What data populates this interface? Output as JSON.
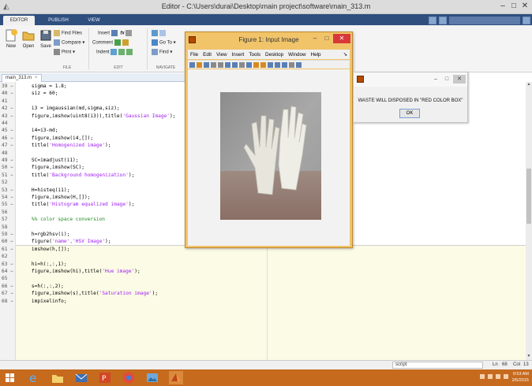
{
  "window": {
    "title": "Editor - C:\\Users\\durai\\Desktop\\main project\\software\\main_313.m",
    "controls": [
      "–",
      "□",
      "✕"
    ]
  },
  "ribbon_tabs": [
    {
      "label": "EDITOR"
    },
    {
      "label": "PUBLISH"
    },
    {
      "label": "VIEW"
    }
  ],
  "ribbon": {
    "new_label": "New",
    "open_label": "Open",
    "save_label": "Save",
    "find_files_label": "Find Files",
    "compare_label": "Compare ▾",
    "print_label": "Print ▾",
    "insert_label": "Insert",
    "comment_label": "Comment",
    "indent_label": "Indent",
    "goto_label": "Go To ▾",
    "find_label": "Find ▾",
    "section_file": "FILE",
    "section_edit": "EDIT",
    "section_navigate": "NAVIGATE"
  },
  "editor": {
    "doc_tab": "main_313.m",
    "lines": [
      {
        "n": "39 −",
        "code": "    sigma = 1.8;"
      },
      {
        "n": "40 −",
        "code": "    siz = 60;"
      },
      {
        "n": "41",
        "code": ""
      },
      {
        "n": "42 −",
        "code": "    i3 = imgaussian(md,sigma,siz);"
      },
      {
        "n": "43 −",
        "code": "    figure,imshow(uint8(i3)),title(",
        "str": "'Gaussian Image'",
        "tail": ");"
      },
      {
        "n": "44",
        "code": ""
      },
      {
        "n": "45 −",
        "code": "    i4=i3-md;"
      },
      {
        "n": "46 −",
        "code": "    figure,imshow(i4,[]);"
      },
      {
        "n": "47 −",
        "code": "    title(",
        "str": "'Homogenized image'",
        "tail": ");"
      },
      {
        "n": "48",
        "code": ""
      },
      {
        "n": "49 −",
        "code": "    SC=imadjust(i1);"
      },
      {
        "n": "50 −",
        "code": "    figure,imshow(SC);"
      },
      {
        "n": "51 −",
        "code": "    title(",
        "str": "'Background homogenization'",
        "tail": ");"
      },
      {
        "n": "52",
        "code": ""
      },
      {
        "n": "53 −",
        "code": "    H=histeq(i1);"
      },
      {
        "n": "54 −",
        "code": "    figure,imshow(H,[]);"
      },
      {
        "n": "55 −",
        "code": "    title(",
        "str": "'Histogram equalized image'",
        "tail": ");"
      },
      {
        "n": "56",
        "code": ""
      },
      {
        "n": "57",
        "code": "    ",
        "cmt": "%% color space conversion"
      },
      {
        "n": "58",
        "code": ""
      },
      {
        "n": "59 −",
        "code": "    h=rgb2hsv(i);"
      },
      {
        "n": "60 −",
        "code": "    figure(",
        "str": "'name','HSV Image'",
        "tail": ");"
      },
      {
        "n": "61 −",
        "code": "    imshow(h,[]);"
      },
      {
        "n": "62",
        "code": ""
      },
      {
        "n": "63 −",
        "code": "    hi=h(:,:,1);"
      },
      {
        "n": "64 −",
        "code": "    figure,imshow(hi),title(",
        "str": "'Hue image'",
        "tail": ");"
      },
      {
        "n": "65",
        "code": ""
      },
      {
        "n": "66 −",
        "code": "    s=h(:,:,2);"
      },
      {
        "n": "67 −",
        "code": "    figure,imshow(s),title(",
        "str": "'Saturation image'",
        "tail": ");"
      },
      {
        "n": "68 −",
        "code": "    impixelinfo;"
      }
    ]
  },
  "figure": {
    "title": "Figure 1: Input Image",
    "menu": [
      "File",
      "Edit",
      "View",
      "Insert",
      "Tools",
      "Desktop",
      "Window",
      "Help"
    ]
  },
  "msgbox": {
    "text": "WASTE WILL DISPOSED IN \"RED COLOR BOX\"",
    "ok_label": "OK"
  },
  "status": {
    "mode": "script",
    "ln_label": "Ln",
    "ln_value": "68",
    "col_label": "Col",
    "col_value": "13"
  },
  "taskbar": {
    "time": "9:53 AM",
    "date": "2/5/2015"
  }
}
